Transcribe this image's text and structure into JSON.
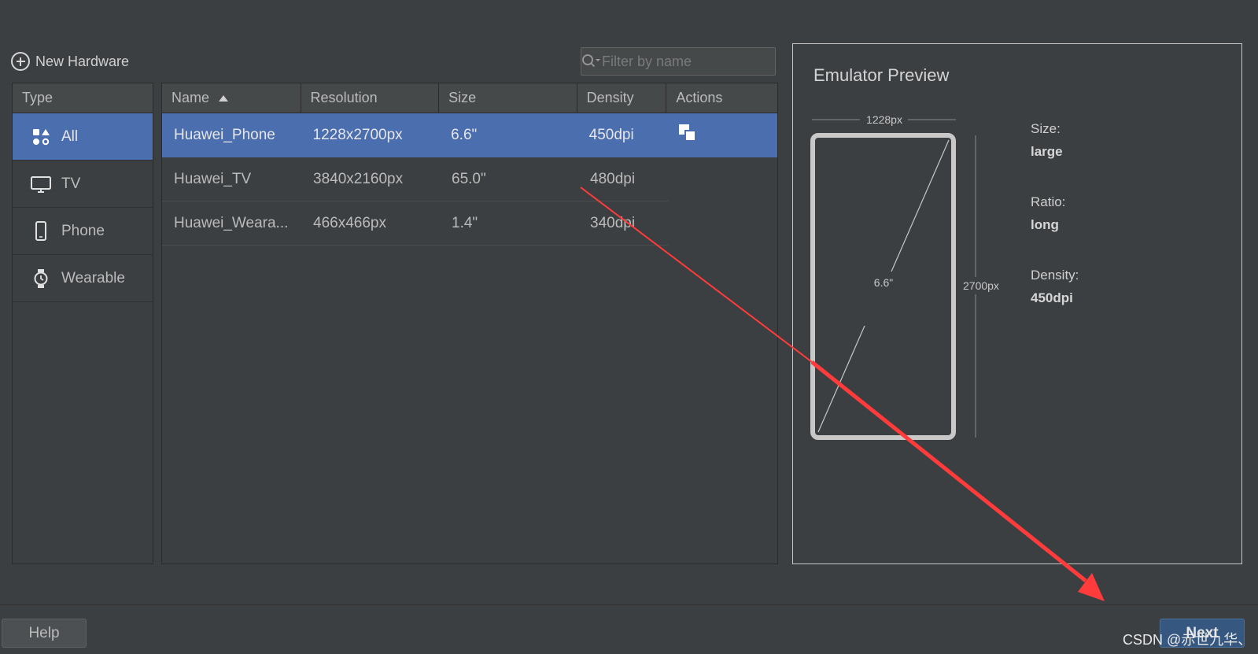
{
  "toolbar": {
    "new_hardware_label": "New Hardware",
    "search_placeholder": "Filter by name"
  },
  "type_panel": {
    "header": "Type",
    "items": [
      {
        "label": "All",
        "icon": "grid-shapes-icon",
        "selected": true
      },
      {
        "label": "TV",
        "icon": "tv-icon",
        "selected": false
      },
      {
        "label": "Phone",
        "icon": "phone-icon",
        "selected": false
      },
      {
        "label": "Wearable",
        "icon": "watch-icon",
        "selected": false
      }
    ]
  },
  "device_table": {
    "columns": [
      "Name",
      "Resolution",
      "Size",
      "Density",
      "Actions"
    ],
    "sort_column": "Name",
    "sort_direction": "ascending",
    "rows": [
      {
        "name": "Huawei_Phone",
        "resolution": "1228x2700px",
        "size": "6.6\"",
        "density": "450dpi",
        "action_icon": "clone-icon",
        "selected": true
      },
      {
        "name": "Huawei_TV",
        "resolution": "3840x2160px",
        "size": "65.0\"",
        "density": "480dpi",
        "selected": false
      },
      {
        "name": "Huawei_Weara...",
        "resolution": "466x466px",
        "size": "1.4\"",
        "density": "340dpi",
        "selected": false
      }
    ]
  },
  "preview": {
    "title": "Emulator Preview",
    "width_label": "1228px",
    "height_label": "2700px",
    "diagonal_label": "6.6\"",
    "specs": [
      {
        "label": "Size:",
        "value": "large"
      },
      {
        "label": "Ratio:",
        "value": "long"
      },
      {
        "label": "Density:",
        "value": "450dpi"
      }
    ]
  },
  "footer": {
    "help_label": "Help",
    "next_label": "Next",
    "watermark": "CSDN @赤世九华、"
  },
  "colors": {
    "background": "#3c3f41",
    "selection": "#4b6eaf",
    "annotation_arrow": "#ff3b3b"
  }
}
